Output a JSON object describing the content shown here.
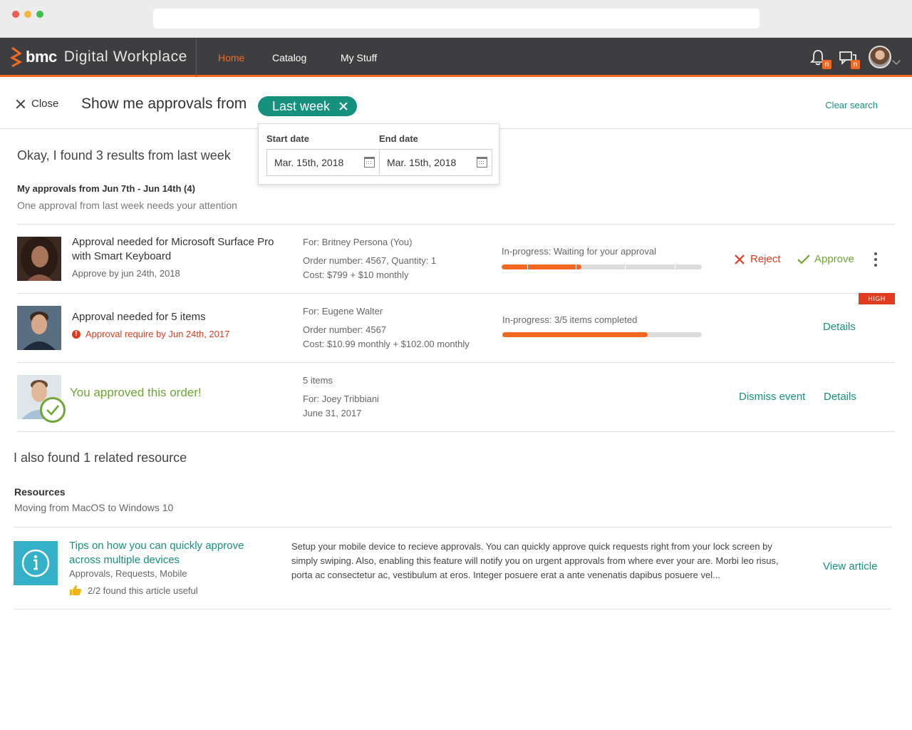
{
  "app": {
    "brand": "bmc",
    "product": "Digital Workplace",
    "nav": [
      {
        "label": "Home",
        "active": true
      },
      {
        "label": "Catalog",
        "active": false
      },
      {
        "label": "My Stuff",
        "active": false
      }
    ],
    "notification_badge": "n",
    "chat_badge": "n"
  },
  "search": {
    "close_label": "Close",
    "query": "Show me approvals from",
    "chip": "Last week",
    "clear_label": "Clear search"
  },
  "date_filter": {
    "start_label": "Start date",
    "start_value": "Mar. 15th, 2018",
    "end_label": "End date",
    "end_value": "Mar. 15th, 2018"
  },
  "results": {
    "summary": "Okay, I found 3 results from last week",
    "section_title": "My approvals from Jun 7th - Jun 14th (4)",
    "section_sub": "One approval from last week needs your attention",
    "items": [
      {
        "title": "Approval needed for Microsoft Surface Pro with Smart Keyboard",
        "subtitle": "Approve by jun 24th, 2018",
        "for": "For: Britney Persona (You)",
        "order": "Order number: 4567,  Quantity: 1",
        "cost": "Cost: $799 + $10 monthly",
        "status": "In-progress: Waiting for your approval",
        "progress": 0.4,
        "reject_label": "Reject",
        "approve_label": "Approve"
      },
      {
        "title": "Approval needed for 5 items",
        "warning": "Approval require by Jun 24th, 2017",
        "badge": "HIGH",
        "for": "For: Eugene Walter",
        "order": "Order number: 4567",
        "cost": "Cost: $10.99 monthly + $102.00 monthly",
        "status": "In-progress: 3/5 items completed",
        "progress": 0.73,
        "details_label": "Details"
      },
      {
        "message": "You approved this order!",
        "items": "5 items",
        "for": "For: Joey Tribbiani",
        "date": "June 31, 2017",
        "dismiss_label": "Dismiss event",
        "details_label": "Details"
      }
    ]
  },
  "related": {
    "summary": "I also found 1 related resource",
    "section_title": "Resources",
    "section_sub": "Moving from MacOS to Windows 10",
    "article": {
      "title": "Tips on how you can quickly approve across multiple devices",
      "tags": "Approvals, Requests, Mobile",
      "useful": "2/2 found this article useful",
      "description": "Setup your mobile device to recieve approvals. You can quickly approve quick requests right from your lock screen by simply swiping. Also, enabling this feature will notify you on urgent approvals from where ever your are. Morbi leo risus, porta ac consectetur ac, vestibulum at eros. Integer posuere erat a ante venenatis dapibus posuere vel...",
      "cta": "View article"
    }
  },
  "colors": {
    "accent": "#f26a21",
    "teal": "#16917d",
    "danger": "#e03b1f",
    "success": "#6ea634"
  }
}
